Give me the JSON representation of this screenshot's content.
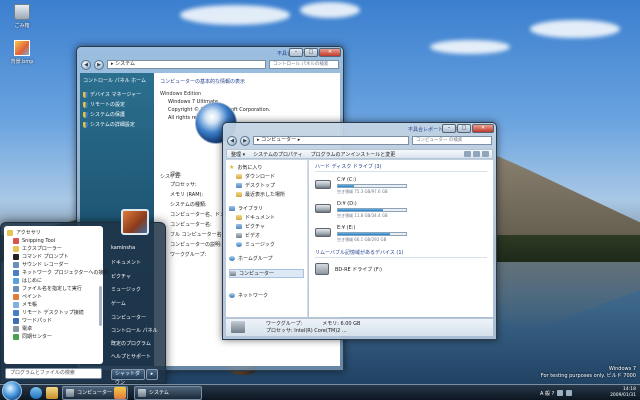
{
  "desktop": {
    "icons": [
      {
        "label": "ごみ箱",
        "icon": "recycle-bin-icon"
      },
      {
        "label": "背景.bmp",
        "icon": "bitmap-file-icon"
      }
    ],
    "watermark_line1": "Windows 7",
    "watermark_line2": "For testing purposes only. ビルド 7000"
  },
  "control_panel_window": {
    "title": "不具合レポートの送信",
    "address": "▸ システム",
    "search_placeholder": "コントロール パネルの検索",
    "left_home": "コントロール パネル ホーム",
    "left_links": [
      "デバイス マネージャー",
      "リモートの設定",
      "システムの保護",
      "システムの詳細設定"
    ],
    "heading": "コンピューターの基本的な情報の表示",
    "edition_section": "Windows Edition",
    "edition": "Windows 7 Ultimate",
    "copyright": "Copyright © 2008 Microsoft Corporation.",
    "rights": "All rights reserved.",
    "system_section": "システム",
    "labels": [
      "評価:",
      "プロセッサ:",
      "",
      "メモリ (RAM):",
      "システムの種類:",
      "コンピューター名、ドメイン",
      "コンピューター名:",
      "フル コンピューター名:",
      "コンピューターの説明:",
      "ワークグループ:"
    ]
  },
  "computer_window": {
    "title": "不具合レポートの送信",
    "address": "▸ コンピューター ▸",
    "search_placeholder": "コンピューター の検索",
    "cmd_organize": "整理 ▾",
    "cmd_properties": "システムのプロパティ",
    "cmd_uninstall": "プログラムのアンインストールと変更",
    "nav": {
      "favorites": "お気に入り",
      "fav_items": [
        "ダウンロード",
        "デスクトップ",
        "最近表示した場所"
      ],
      "libraries": "ライブラリ",
      "lib_items": [
        "ドキュメント",
        "ピクチャ",
        "ビデオ",
        "ミュージック"
      ],
      "homegroup": "ホームグループ",
      "computer": "コンピューター",
      "network": "ネットワーク"
    },
    "group_hdd": "ハード ディスク ドライブ (3)",
    "drives": [
      {
        "name": "C:¥ (C:)",
        "free": "空き領域 75.3 GB/97.6 GB",
        "used": 0.23
      },
      {
        "name": "D:¥ (D:)",
        "free": "空き領域 11.8 GB/34.4 GB",
        "used": 0.66
      },
      {
        "name": "E:¥ (E:)",
        "free": "空き領域 66.1 GB/292 GB",
        "used": 0.77
      }
    ],
    "group_removable": "リムーバブル記憶域があるデバイス (1)",
    "bd_drive": "BD-RE ドライブ (F:)",
    "details_workgroup_label": "ワークグループ:",
    "details_memory": "メモリ: 6.00 GB",
    "details_processor": "プロセッサ: Intel(R) Core(TM)2 ..."
  },
  "start_menu": {
    "programs": [
      {
        "label": "アクセサリ",
        "sub": false,
        "color": "#e8c35a"
      },
      {
        "label": "Snipping Tool",
        "sub": true,
        "color": "#d9534f"
      },
      {
        "label": "エクスプローラー",
        "sub": true,
        "color": "#e8c35a"
      },
      {
        "label": "コマンド プロンプト",
        "sub": true,
        "color": "#222222"
      },
      {
        "label": "サウンド レコーダー",
        "sub": true,
        "color": "#6c8ebf"
      },
      {
        "label": "ネットワーク プロジェクターへの接続",
        "sub": true,
        "color": "#4a7fc1"
      },
      {
        "label": "はじめに",
        "sub": true,
        "color": "#5aa0dc"
      },
      {
        "label": "ファイル名を指定して実行",
        "sub": true,
        "color": "#6b8fb3"
      },
      {
        "label": "ペイント",
        "sub": true,
        "color": "#e07b39"
      },
      {
        "label": "メモ帳",
        "sub": true,
        "color": "#7fb1dd"
      },
      {
        "label": "リモート デスクトップ接続",
        "sub": true,
        "color": "#4a7fc1"
      },
      {
        "label": "ワードパッド",
        "sub": true,
        "color": "#3c6fb0"
      },
      {
        "label": "電卓",
        "sub": true,
        "color": "#8896a4"
      },
      {
        "label": "同期センター",
        "sub": true,
        "color": "#49a34a"
      }
    ],
    "search_placeholder": "プログラムとファイルの検索",
    "user": "kaminsha",
    "right_items": [
      "ドキュメント",
      "ピクチャ",
      "ミュージック",
      "ゲーム",
      "コンピューター",
      "コントロール パネル",
      "既定のプログラム",
      "ヘルプとサポート"
    ],
    "shutdown": "シャットダウン",
    "shutdown_arrow": "▸"
  },
  "taskbar": {
    "buttons": [
      "コンピューター",
      "システム"
    ],
    "clock_time": "14:18",
    "clock_date": "2009/01/31",
    "tray_label": "A 般 ?"
  }
}
